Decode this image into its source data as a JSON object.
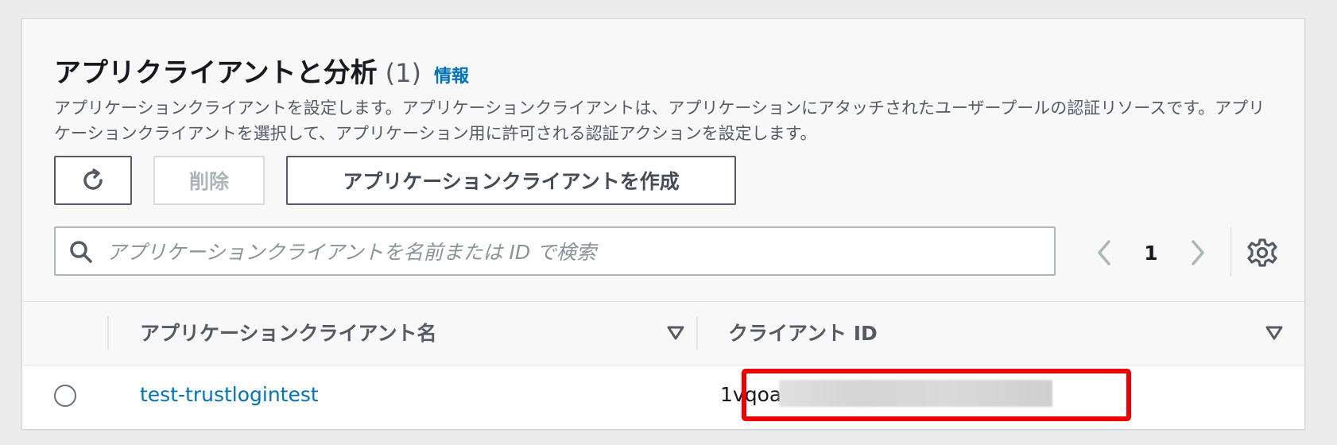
{
  "section": {
    "title": "アプリクライアントと分析",
    "count": "(1)",
    "info_link": "情報",
    "description": "アプリケーションクライアントを設定します。アプリケーションクライアントは、アプリケーションにアタッチされたユーザープールの認証リソースです。アプリケーションクライアントを選択して、アプリケーション用に許可される認証アクションを設定します。"
  },
  "toolbar": {
    "refresh_icon": "refresh-icon",
    "delete_label": "削除",
    "create_label": "アプリケーションクライアントを作成"
  },
  "search": {
    "placeholder": "アプリケーションクライアントを名前または ID で検索",
    "value": ""
  },
  "pagination": {
    "current_page": "1"
  },
  "table": {
    "columns": [
      {
        "label": "アプリケーションクライアント名"
      },
      {
        "label": "クライアント ID"
      }
    ],
    "rows": [
      {
        "name": "test-trustlogintest",
        "client_id": "1vqoa"
      }
    ]
  },
  "colors": {
    "accent_link": "#0073bb",
    "highlight": "#ee0000"
  }
}
